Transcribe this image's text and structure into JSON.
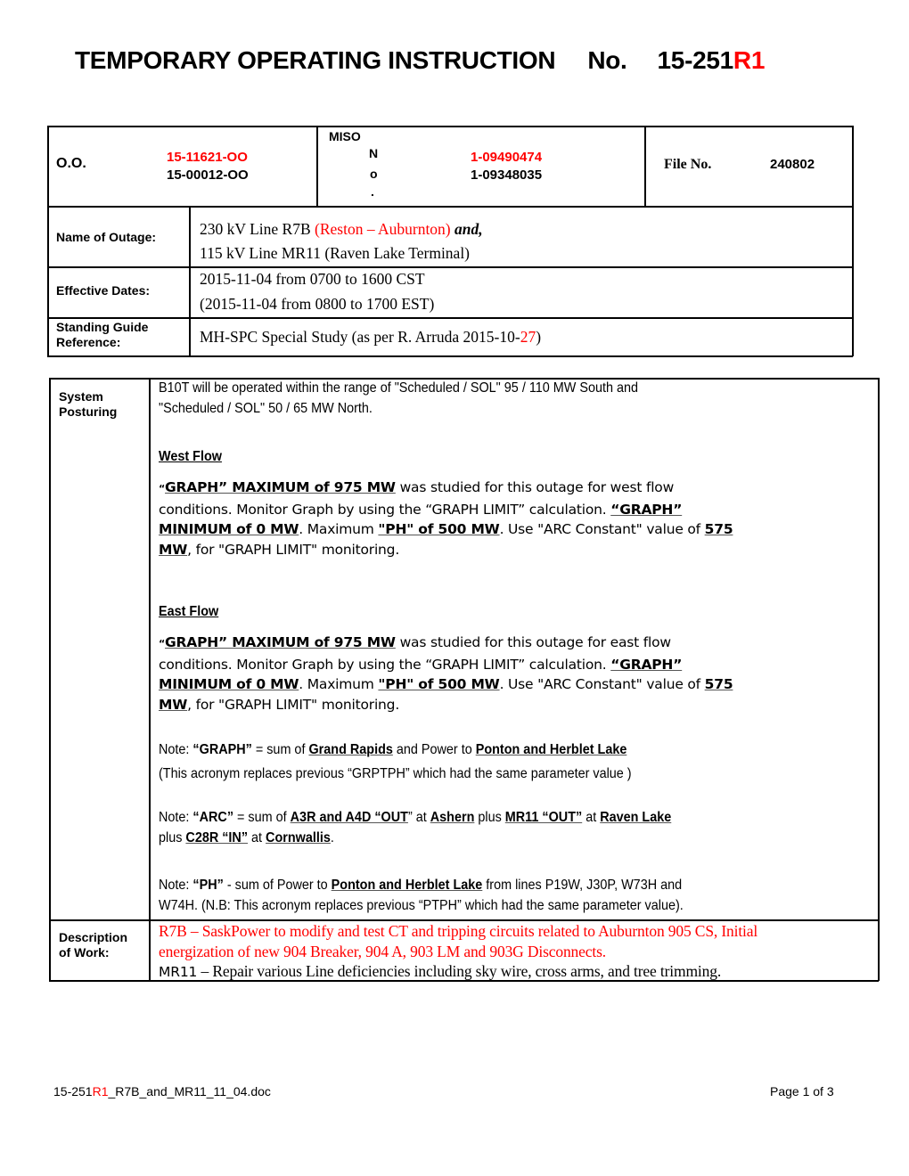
{
  "header": {
    "title": "TEMPORARY OPERATING INSTRUCTION",
    "no_label": "No.",
    "number_base": "15-251",
    "number_revision": "R1"
  },
  "info_table": {
    "oo_label": "O.O.",
    "oo_numbers": [
      "15-11621-OO",
      "15-00012-OO"
    ],
    "miso_label": "MISO",
    "miso_no_letters": [
      "N",
      "o",
      "."
    ],
    "miso_numbers": [
      "1-09490474",
      "1-09348035"
    ],
    "file_no_label": "File No.",
    "file_no_value": "240802",
    "name_of_outage_label": "Name of Outage:",
    "name_of_outage_line1_a": "230 kV Line R7B ",
    "name_of_outage_line1_red": "(Reston – Auburnton)",
    "name_of_outage_line1_b": " and,",
    "name_of_outage_line2": "115 kV Line MR11 (Raven Lake Terminal)",
    "effective_dates_label": "Effective Dates:",
    "effective_dates_line1": "2015-11-04 from 0700 to 1600 CST",
    "effective_dates_line2": "(2015-11-04 from 0800 to 1700 EST)",
    "standing_guide_label_1": "Standing Guide",
    "standing_guide_label_2": "Reference:",
    "standing_guide_value_a": "MH-SPC Special Study (as per R. Arruda 2015-10-",
    "standing_guide_value_red": "27",
    "standing_guide_value_b": ")"
  },
  "posture_table": {
    "system_posturing_label_1": "System",
    "system_posturing_label_2": "Posturing",
    "intro_line1": "B10T will be operated within the range of \"Scheduled / SOL\"  95 / 110 MW South and",
    "intro_line2": "\"Scheduled / SOL\"  50 / 65 MW North.",
    "west": {
      "heading": "West Flow",
      "p_open_quote": "“",
      "p_max": "GRAPH” MAXIMUM of  975 MW",
      "p_text1": " was studied for this outage for west flow",
      "p_line2": "conditions. Monitor Graph by using the “GRAPH LIMIT” calculation. ",
      "p_min_a": "“GRAPH” ",
      "p_min_b": "MINIMUM of  0 MW",
      "p_text2": ". Maximum ",
      "p_ph": "\"PH\" of 500 MW",
      "p_text3": ". Use \"ARC Constant\" value of ",
      "p_arc_a": "575",
      "p_arc_b": "MW",
      "p_text4": ", for \"GRAPH LIMIT\" monitoring."
    },
    "east": {
      "heading": "East Flow",
      "p_open_quote": "“",
      "p_max": "GRAPH” MAXIMUM of  975 MW",
      "p_text1": " was studied for this outage for east flow",
      "p_line2": "conditions. Monitor Graph by using the “GRAPH LIMIT” calculation. ",
      "p_min_a": "“GRAPH” ",
      "p_min_b": "MINIMUM of  0 MW",
      "p_text2": ". Maximum ",
      "p_ph": "\"PH\" of 500 MW",
      "p_text3": ". Use \"ARC Constant\" value of ",
      "p_arc_a": "575",
      "p_arc_b": "MW",
      "p_text4": ", for \"GRAPH LIMIT\" monitoring."
    },
    "note_graph": {
      "prefix": "Note: ",
      "term": "“GRAPH”",
      "t1": " = sum of ",
      "grand_rapids": "Grand Rapids",
      "t2": " and Power to ",
      "ponton": "Ponton and Herblet Lake ",
      "line2": "(This acronym replaces previous “GRPTPH” which had the same parameter value )"
    },
    "note_arc": {
      "prefix": "Note:  ",
      "term": "“ARC”",
      "t1": " =  sum of ",
      "a3r": "A3R and A4D “OUT",
      "t2": "” at ",
      "ashern": "Ashern",
      "t3": " plus ",
      "mr11": "MR11 “OUT”",
      "t4": " at ",
      "raven": "Raven Lake",
      "l2_t1": "plus ",
      "c28r": "C28R “IN”",
      "l2_t2": " at ",
      "cornwallis": "Cornwallis",
      "l2_t3": "."
    },
    "note_ph": {
      "prefix": "Note:  ",
      "term": "“PH”",
      "t1": " - sum of Power to ",
      "ponton": "Ponton and Herblet Lake",
      "t2": " from lines P19W, J30P, W73H and",
      "line2": "W74H.  (N.B: This acronym replaces previous “PTPH” which had the same parameter value)."
    },
    "description_label_1": "Description",
    "description_label_2": "of Work:",
    "description_line1": "R7B – SaskPower to modify and test CT and tripping circuits related to Auburnton 905 CS, Initial",
    "description_line2": "energization of new 904 Breaker, 904 A, 903 LM and 903G Disconnects.",
    "description_line3_a": "MR11",
    "description_line3_b": " – Repair various Line deficiencies including sky wire, cross arms, and tree trimming."
  },
  "footer": {
    "filename_a": "15-251",
    "filename_red": "R1",
    "filename_b": "_R7B_and_MR11_11_04.doc",
    "page": "Page 1 of 3"
  }
}
